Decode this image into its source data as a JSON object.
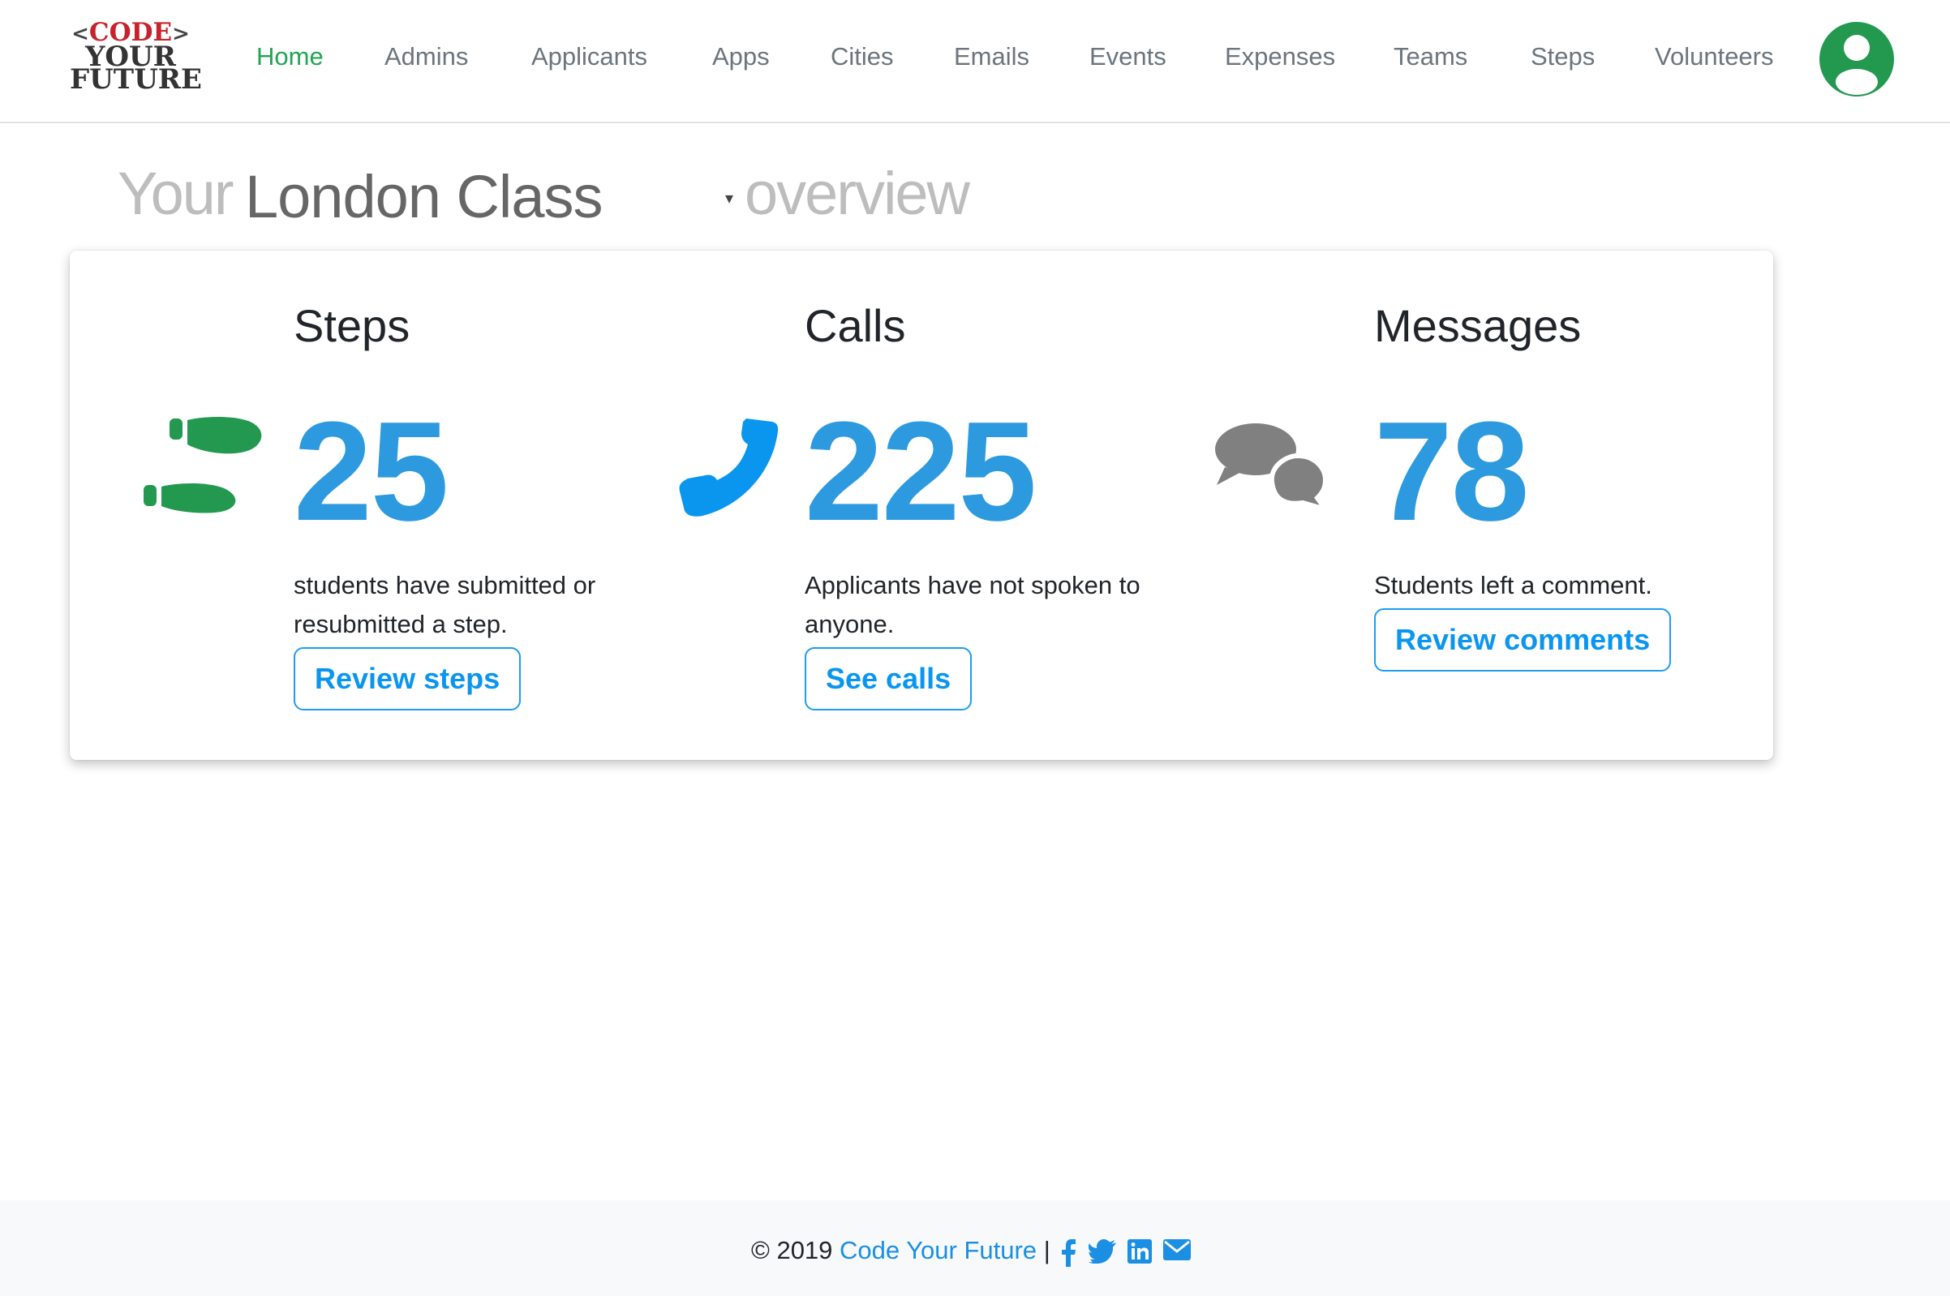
{
  "logo": {
    "line1": "CODE",
    "lt": "<",
    "gt": ">",
    "line2": "YOUR",
    "line3": "FUTURE"
  },
  "nav": {
    "items": [
      {
        "label": "Home",
        "active": true
      },
      {
        "label": "Admins"
      },
      {
        "label": "Applicants"
      },
      {
        "label": "Apps"
      },
      {
        "label": "Cities"
      },
      {
        "label": "Emails"
      },
      {
        "label": "Events"
      },
      {
        "label": "Expenses"
      },
      {
        "label": "Teams"
      },
      {
        "label": "Steps"
      },
      {
        "label": "Volunteers"
      }
    ],
    "avatar_icon": "user-circle-icon"
  },
  "heading": {
    "prefix": "Your",
    "selected_class": "London Class",
    "suffix": "overview",
    "caret": "▾"
  },
  "stats": [
    {
      "title": "Steps",
      "number": "25",
      "description": "students have submitted or resubmitted a step.",
      "button": "Review steps",
      "icon": "shoe-prints-icon",
      "icon_color": "#23994f"
    },
    {
      "title": "Calls",
      "number": "225",
      "description": "Applicants have not spoken to anyone.",
      "button": "See calls",
      "icon": "phone-icon",
      "icon_color": "#0a96ef"
    },
    {
      "title": "Messages",
      "number": "78",
      "description": "Students left a comment.",
      "button": "Review comments",
      "icon": "comments-icon",
      "icon_color": "#808080"
    }
  ],
  "colors": {
    "accent_green": "#23a455",
    "stat_blue": "#2d9ae0",
    "link_blue": "#0a96ef"
  },
  "footer": {
    "copyright": "© 2019",
    "org_name": "Code Your Future",
    "separator": "|",
    "social_icons": [
      "facebook-icon",
      "twitter-icon",
      "linkedin-icon",
      "envelope-icon"
    ]
  }
}
